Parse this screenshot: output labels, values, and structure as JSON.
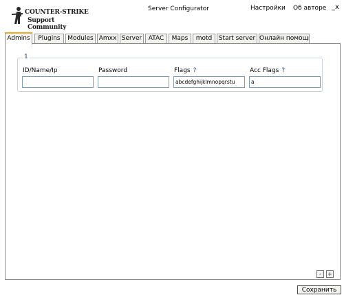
{
  "header": {
    "logo_line1": "COUNTER-STRIKE",
    "logo_line2": "Support Community",
    "title": "Server Configurator",
    "menu": {
      "settings": "Настройки",
      "about": "Об авторе"
    },
    "minimize": "_x"
  },
  "tabs": [
    {
      "label": "Admins",
      "active": true
    },
    {
      "label": "Plugins"
    },
    {
      "label": "Modules"
    },
    {
      "label": "Amxx"
    },
    {
      "label": "Server"
    },
    {
      "label": "ATAC"
    },
    {
      "label": "Maps"
    },
    {
      "label": "motd"
    },
    {
      "label": "Start server"
    },
    {
      "label": "Онлайн помощь"
    }
  ],
  "admin_entry": {
    "index": "1",
    "fields": {
      "id": {
        "label": "ID/Name/Ip",
        "value": ""
      },
      "password": {
        "label": "Password",
        "value": ""
      },
      "flags": {
        "label": "Flags",
        "help": "?",
        "value": "abcdefghijklmnopqrstu"
      },
      "acc_flags": {
        "label": "Acc Flags",
        "help": "?",
        "value": "a"
      }
    }
  },
  "controls": {
    "remove": "-",
    "add": "+",
    "save": "Сохранить"
  },
  "colors": {
    "accent_tab": "#f5a623",
    "help_mark": "#1c3f94",
    "input_border": "#7f9db9"
  }
}
